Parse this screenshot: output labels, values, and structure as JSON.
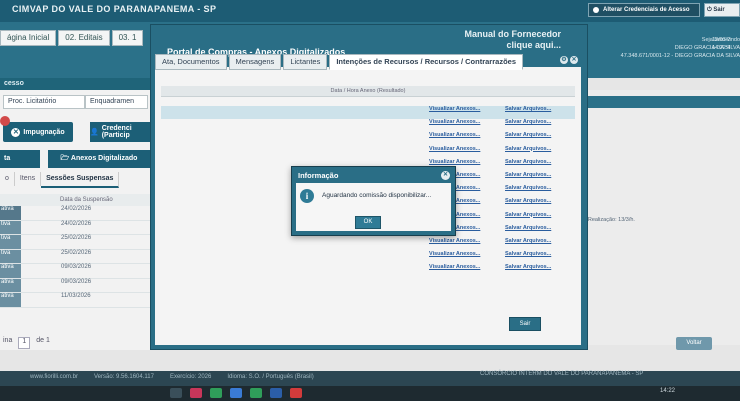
{
  "topbar": {
    "title": "CIMVAP DO VALE DO PARANAPANEMA - SP",
    "alter_label": "Alterar Credenciais de Acesso",
    "logout_label": "Sair"
  },
  "main_tabs": [
    "ágina Inicial",
    "02. Editais",
    "03. 1"
  ],
  "right_info": [
    "Seja bem-vindo",
    "DIEGO GRACIA DA SILVA",
    "47.348.671/0001-12 - DIEGO GRACIA DA SILVA",
    "12/03/2",
    "14:22:4"
  ],
  "left": {
    "section_label": "cesso",
    "headers": [
      "Proc. Licitatório",
      "Enquadramen"
    ],
    "btn_impugnacao": "Impugnação",
    "btn_credenciamento": "Credenci (Particip",
    "btn_lg": "ta",
    "btn_anexos": "Anexos Digitalizado",
    "subtabs": [
      "o",
      "Itens",
      "Sessões Suspensas"
    ],
    "table_header": "Data da Suspensão",
    "rows": [
      {
        "s": "ativa",
        "d": "24/02/2026"
      },
      {
        "s": "tiva",
        "d": "24/02/2026"
      },
      {
        "s": "tiva",
        "d": "25/02/2026"
      },
      {
        "s": "tiva",
        "d": "25/02/2026"
      },
      {
        "s": "ativa",
        "d": "09/03/2026"
      },
      {
        "s": "ativa",
        "d": "09/03/2026"
      },
      {
        "s": "ativa",
        "d": "11/03/2026"
      }
    ],
    "pager": [
      "ina",
      "1",
      "de 1"
    ]
  },
  "window": {
    "title": "Portal de Compras - Anexos Digitalizados",
    "manual_line1": "Manual do Fornecedor",
    "manual_line2": "clique aqui...",
    "tabs": [
      "Ata, Documentos",
      "Mensagens",
      "Lictantes",
      "Intenções de Recursos / Recursos / Contrarrazões"
    ],
    "annex_header": "Data / Hora Anexo (Resultado)",
    "link_view": "Visualizar Anexos...",
    "link_save": "Salvar Arquivos...",
    "btn_sair": "Sair"
  },
  "dialog": {
    "title": "Informação",
    "message": "Aguardando comissão disponibilizar...",
    "ok_label": "OK"
  },
  "right_row_text": "eração: Realização: 13/3/h.",
  "btn_voltar": "Voltar",
  "footer": {
    "site": "www.fiorilli.com.br",
    "version": "Versão: 9.56.1604.117",
    "exercise": "Exercício: 2026",
    "locale": "Idioma: S.O. / Português (Brasil)",
    "consortium": "CONSÓRCIO INTERM DO VALE DO PARANAPANEMA - SP"
  },
  "clock": "14:22"
}
